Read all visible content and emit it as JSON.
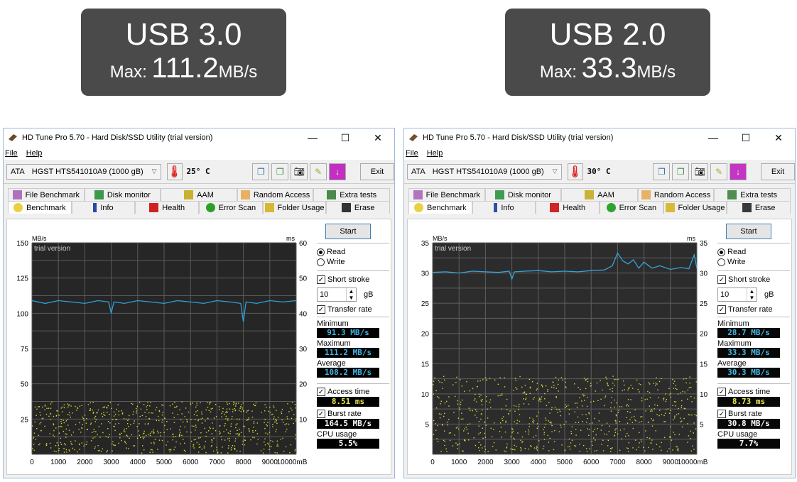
{
  "banners": [
    {
      "title": "USB 3.0",
      "max_label": "Max:",
      "max_value": "111.2",
      "max_unit": "MB/s"
    },
    {
      "title": "USB 2.0",
      "max_label": "Max:",
      "max_value": "33.3",
      "max_unit": "MB/s"
    }
  ],
  "windows": [
    {
      "title": "HD Tune Pro 5.70 - Hard Disk/SSD Utility (trial version)",
      "menu": [
        "File",
        "Help"
      ],
      "drive_type": "ATA",
      "drive_name": "HGST HTS541010A9 (1000 gB)",
      "temperature": "25° C",
      "exit_label": "Exit",
      "tabs_row1": [
        "File Benchmark",
        "Disk monitor",
        "AAM",
        "Random Access",
        "Extra tests"
      ],
      "tabs_row2": [
        "Benchmark",
        "Info",
        "Health",
        "Error Scan",
        "Folder Usage",
        "Erase"
      ],
      "side": {
        "start": "Start",
        "read": "Read",
        "write": "Write",
        "short_stroke": "Short stroke",
        "stroke_value": "10",
        "stroke_unit": "gB",
        "transfer_rate": "Transfer rate",
        "minimum_label": "Minimum",
        "minimum": "91.3 MB/s",
        "maximum_label": "Maximum",
        "maximum": "111.2 MB/s",
        "average_label": "Average",
        "average": "108.2 MB/s",
        "access_time_label": "Access time",
        "access_time": "8.51 ms",
        "burst_rate_label": "Burst rate",
        "burst_rate": "164.5 MB/s",
        "cpu_label": "CPU usage",
        "cpu": "5.5%"
      }
    },
    {
      "title": "HD Tune Pro 5.70 - Hard Disk/SSD Utility (trial version)",
      "menu": [
        "File",
        "Help"
      ],
      "drive_type": "ATA",
      "drive_name": "HGST HTS541010A9 (1000 gB)",
      "temperature": "30° C",
      "exit_label": "Exit",
      "tabs_row1": [
        "File Benchmark",
        "Disk monitor",
        "AAM",
        "Random Access",
        "Extra tests"
      ],
      "tabs_row2": [
        "Benchmark",
        "Info",
        "Health",
        "Error Scan",
        "Folder Usage",
        "Erase"
      ],
      "side": {
        "start": "Start",
        "read": "Read",
        "write": "Write",
        "short_stroke": "Short stroke",
        "stroke_value": "10",
        "stroke_unit": "gB",
        "transfer_rate": "Transfer rate",
        "minimum_label": "Minimum",
        "minimum": "28.7 MB/s",
        "maximum_label": "Maximum",
        "maximum": "33.3 MB/s",
        "average_label": "Average",
        "average": "30.3 MB/s",
        "access_time_label": "Access time",
        "access_time": "8.73 ms",
        "burst_rate_label": "Burst rate",
        "burst_rate": "30.8 MB/s",
        "cpu_label": "CPU usage",
        "cpu": "7.7%"
      }
    }
  ],
  "chart_data": [
    {
      "type": "line",
      "ylabel": "MB/s",
      "y2label": "ms",
      "watermark": "trial version",
      "xunit": "mB",
      "ylim": [
        0,
        150
      ],
      "y2lim": [
        0,
        60
      ],
      "yticks": [
        "150",
        "125",
        "100",
        "75",
        "50",
        "25"
      ],
      "y2ticks": [
        "60",
        "50",
        "40",
        "30",
        "20",
        "10"
      ],
      "xticks": [
        "0",
        "1000",
        "2000",
        "3000",
        "4000",
        "5000",
        "6000",
        "7000",
        "8000",
        "9000",
        "10000mB"
      ],
      "series": [
        {
          "name": "Transfer rate",
          "x": [
            0,
            500,
            1000,
            1500,
            2000,
            2500,
            2900,
            3000,
            3100,
            3500,
            4000,
            4500,
            5000,
            5500,
            6000,
            6500,
            7000,
            7500,
            7900,
            8000,
            8100,
            8500,
            9000,
            9500,
            10000
          ],
          "values": [
            109,
            107,
            109,
            108,
            107,
            109,
            108,
            100,
            108,
            107,
            109,
            108,
            107,
            109,
            108,
            107,
            109,
            108,
            107,
            94,
            108,
            107,
            109,
            108,
            109
          ]
        }
      ],
      "access_time_ms": {
        "min": 0.5,
        "max": 15,
        "count": 700,
        "color": "#d8d830"
      },
      "line_color": "#2f9fd8"
    },
    {
      "type": "line",
      "ylabel": "MB/s",
      "y2label": "ms",
      "watermark": "trial version",
      "xunit": "mB",
      "ylim": [
        0,
        35
      ],
      "y2lim": [
        0,
        35
      ],
      "yticks": [
        "35",
        "30",
        "25",
        "20",
        "15",
        "10",
        "5"
      ],
      "y2ticks": [
        "35",
        "30",
        "25",
        "20",
        "15",
        "10",
        "5"
      ],
      "xticks": [
        "0",
        "1000",
        "2000",
        "3000",
        "4000",
        "5000",
        "6000",
        "7000",
        "8000",
        "9000",
        "10000mB"
      ],
      "series": [
        {
          "name": "Transfer rate",
          "x": [
            0,
            500,
            1000,
            1500,
            2000,
            2500,
            2900,
            3000,
            3100,
            3500,
            4000,
            4500,
            5000,
            5500,
            6000,
            6500,
            6800,
            7000,
            7200,
            7400,
            7600,
            7800,
            8000,
            8300,
            8600,
            9000,
            9400,
            9700,
            9900,
            10000
          ],
          "values": [
            30.1,
            30.2,
            30.0,
            30.3,
            30.2,
            30.1,
            30.3,
            29.0,
            30.2,
            30.3,
            30.4,
            30.2,
            30.3,
            30.2,
            30.4,
            30.5,
            31.2,
            33.3,
            32.0,
            31.5,
            32.2,
            30.8,
            31.8,
            30.8,
            31.2,
            30.6,
            30.9,
            30.7,
            33.0,
            30.8
          ]
        }
      ],
      "access_time_ms": {
        "min": 0.5,
        "max": 13,
        "count": 700,
        "color": "#d8d830"
      },
      "line_color": "#2f9fd8"
    }
  ]
}
